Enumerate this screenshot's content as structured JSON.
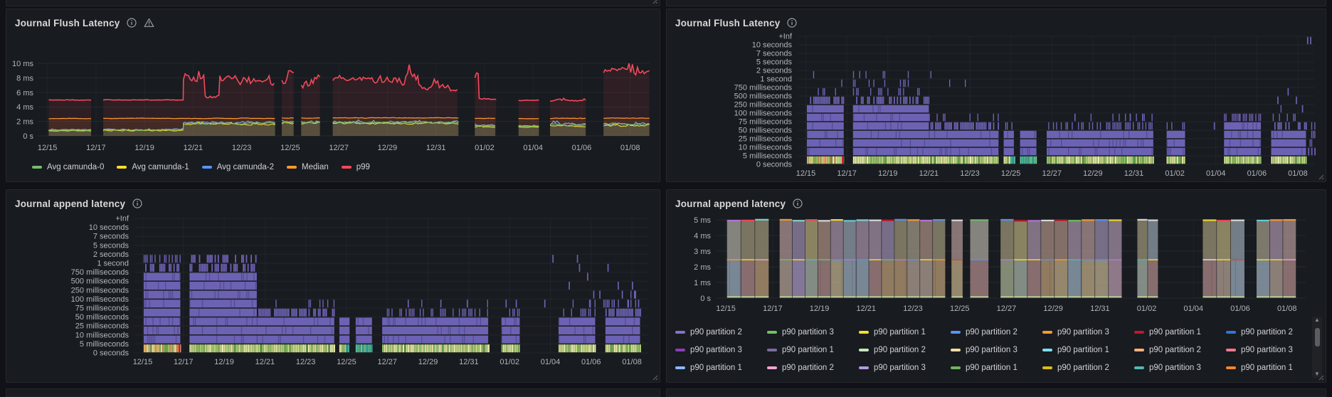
{
  "theme": {
    "page_bg": "#111217",
    "panel_bg": "#181b1f",
    "panel_border": "#25272c",
    "grid": "rgba(204,204,220,0.08)",
    "axis_text": "#b2b6bc",
    "title_text": "#d8d9da",
    "heat_cell": "#6c62b4",
    "heat_dark": "#403a72",
    "red_mark": "#d10e2c"
  },
  "dates": [
    "12/15",
    "12/17",
    "12/19",
    "12/21",
    "12/23",
    "12/25",
    "12/27",
    "12/29",
    "12/31",
    "01/02",
    "01/04",
    "01/06",
    "01/08"
  ],
  "heat_rows": [
    "+Inf",
    "10 seconds",
    "7 seconds",
    "5 seconds",
    "2 seconds",
    "1 second",
    "750 milliseconds",
    "500 milliseconds",
    "250 milliseconds",
    "100 milliseconds",
    "75 milliseconds",
    "50 milliseconds",
    "25 milliseconds",
    "10 milliseconds",
    "5 milliseconds",
    "0 seconds"
  ],
  "panels": {
    "flush_line": {
      "title": "Journal Flush Latency"
    },
    "flush_heatmap": {
      "title": "Journal Flush Latency"
    },
    "append_heatmap": {
      "title": "Journal append latency"
    },
    "append_bars": {
      "title": "Journal append latency",
      "legend_rows": [
        [
          {
            "label": "p90 partition 2",
            "color": "#8173c9"
          },
          {
            "label": "p90 partition 3",
            "color": "#73bf69"
          },
          {
            "label": "p90 partition 1",
            "color": "#fade2a"
          },
          {
            "label": "p90 partition 2",
            "color": "#5794f2"
          },
          {
            "label": "p90 partition 3",
            "color": "#ff9830"
          },
          {
            "label": "p90 partition 1",
            "color": "#c4162a"
          },
          {
            "label": "p90 partition 2",
            "color": "#3274d9"
          }
        ],
        [
          {
            "label": "p90 partition 3",
            "color": "#8f3bb8"
          },
          {
            "label": "p90 partition 1",
            "color": "#7d6b9e"
          },
          {
            "label": "p90 partition 2",
            "color": "#c8e6b8"
          },
          {
            "label": "p90 partition 3",
            "color": "#f0dea0"
          },
          {
            "label": "p90 partition 1",
            "color": "#7edcf2"
          },
          {
            "label": "p90 partition 2",
            "color": "#f7b176"
          },
          {
            "label": "p90 partition 3",
            "color": "#f2778d"
          }
        ],
        [
          {
            "label": "p90 partition 1",
            "color": "#8ab8ff"
          },
          {
            "label": "p90 partition 2",
            "color": "#f2a3d0"
          },
          {
            "label": "p90 partition 3",
            "color": "#b49be0"
          },
          {
            "label": "p90 partition 1",
            "color": "#6fb45f"
          },
          {
            "label": "p90 partition 2",
            "color": "#debb16"
          },
          {
            "label": "p90 partition 3",
            "color": "#54b8ae"
          },
          {
            "label": "p90 partition 1",
            "color": "#f2862c"
          }
        ]
      ]
    }
  },
  "legend_flush": [
    {
      "label": "Avg camunda-0",
      "color": "#73bf69"
    },
    {
      "label": "Avg camunda-1",
      "color": "#fade2a"
    },
    {
      "label": "Avg camunda-2",
      "color": "#5794f2"
    },
    {
      "label": "Median",
      "color": "#ff9830"
    },
    {
      "label": "p99",
      "color": "#f2495c"
    }
  ],
  "chart_data": [
    {
      "id": "flush_line",
      "type": "line",
      "unit": "ms",
      "ylim": [
        0,
        10.4
      ],
      "y_ticks": [
        "10 ms",
        "8 ms",
        "6 ms",
        "4 ms",
        "2 ms",
        "0 s"
      ],
      "series": [
        {
          "name": "p99",
          "color": "#f2495c",
          "fill": "rgba(242,73,92,0.10)",
          "w": 1.6,
          "segments": [
            [
              0.05,
              1.85,
              4.95,
              0.03
            ],
            [
              2.3,
              5.6,
              4.95,
              0.03
            ],
            [
              5.6,
              6.5,
              8.1,
              0.9
            ],
            [
              6.5,
              7.1,
              5.3,
              0.25
            ],
            [
              7.1,
              9.4,
              7.7,
              0.55
            ],
            [
              9.65,
              10.15,
              8.4,
              1.0
            ],
            [
              10.45,
              11.25,
              7.6,
              0.8
            ],
            [
              11.75,
              14.2,
              7.8,
              0.5
            ],
            [
              14.2,
              15.3,
              8.0,
              0.8
            ],
            [
              15.3,
              16.6,
              6.7,
              0.45
            ],
            [
              16.6,
              16.95,
              6.35,
              0.2
            ],
            [
              17.6,
              17.78,
              8.5,
              0.9
            ],
            [
              17.78,
              18.5,
              5.05,
              0.07
            ],
            [
              19.4,
              20.3,
              4.92,
              0.04
            ],
            [
              20.7,
              22.2,
              4.87,
              0.12
            ],
            [
              22.9,
              24.8,
              8.9,
              0.45
            ]
          ]
        },
        {
          "name": "Median",
          "color": "#ff9830",
          "fill": "rgba(255,152,48,0.10)",
          "w": 1.2,
          "segments": [
            [
              0.05,
              1.85,
              2.38,
              0.02
            ],
            [
              2.3,
              9.4,
              2.42,
              0.03
            ],
            [
              9.65,
              10.15,
              2.45,
              0.05
            ],
            [
              10.45,
              11.25,
              2.45,
              0.04
            ],
            [
              11.75,
              16.95,
              2.48,
              0.04
            ],
            [
              17.6,
              18.5,
              2.4,
              0.03
            ],
            [
              19.4,
              20.3,
              2.38,
              0.02
            ],
            [
              20.7,
              22.2,
              2.42,
              0.04
            ],
            [
              22.9,
              24.8,
              2.45,
              0.04
            ]
          ]
        },
        {
          "name": "Avg camunda-2",
          "color": "#8da9dc",
          "fill": "rgba(87,148,242,0.09)",
          "w": 1.1,
          "segments": [
            [
              0.05,
              1.85,
              0.85,
              0.06
            ],
            [
              2.3,
              5.6,
              0.88,
              0.08
            ],
            [
              5.6,
              9.4,
              1.85,
              0.14
            ],
            [
              9.65,
              10.15,
              2.0,
              0.2
            ],
            [
              10.45,
              11.25,
              1.95,
              0.15
            ],
            [
              11.75,
              16.95,
              1.9,
              0.14
            ],
            [
              17.6,
              18.5,
              1.45,
              0.1
            ],
            [
              19.4,
              20.3,
              1.38,
              0.06
            ],
            [
              20.7,
              22.2,
              1.6,
              0.18
            ],
            [
              22.9,
              24.8,
              1.7,
              0.15
            ]
          ]
        },
        {
          "name": "Avg camunda-1",
          "color": "#fade2a",
          "fill": "rgba(250,222,42,0.09)",
          "w": 1.1,
          "segments": [
            [
              0.05,
              1.85,
              0.7,
              0.05
            ],
            [
              2.3,
              5.6,
              0.75,
              0.06
            ],
            [
              5.6,
              9.4,
              1.62,
              0.1
            ],
            [
              9.65,
              10.15,
              1.8,
              0.15
            ],
            [
              10.45,
              11.25,
              1.75,
              0.12
            ],
            [
              11.75,
              16.95,
              1.72,
              0.1
            ],
            [
              17.6,
              18.5,
              1.28,
              0.08
            ],
            [
              19.4,
              20.3,
              1.22,
              0.05
            ],
            [
              20.7,
              22.2,
              1.4,
              0.12
            ],
            [
              22.9,
              24.8,
              1.45,
              0.15
            ]
          ]
        },
        {
          "name": "Avg camunda-0",
          "color": "#73bf69",
          "fill": "rgba(115,191,105,0.11)",
          "w": 1.1,
          "segments": [
            [
              0.05,
              1.85,
              0.78,
              0.05
            ],
            [
              2.3,
              5.6,
              0.82,
              0.07
            ],
            [
              5.6,
              9.4,
              1.72,
              0.1
            ],
            [
              9.65,
              10.15,
              1.9,
              0.15
            ],
            [
              10.45,
              11.25,
              1.85,
              0.12
            ],
            [
              11.75,
              16.95,
              1.82,
              0.1
            ],
            [
              17.6,
              18.5,
              1.38,
              0.08
            ],
            [
              19.4,
              20.3,
              1.32,
              0.05
            ],
            [
              20.7,
              22.2,
              1.55,
              0.15
            ],
            [
              22.9,
              24.8,
              1.65,
              0.12
            ]
          ]
        }
      ]
    },
    {
      "id": "flush_heatmap",
      "type": "heatmap",
      "unit": "latency buckets",
      "chunks": [
        {
          "x": [
            0.05,
            1.85
          ],
          "solid_top": 6,
          "stripes": {
            "7": 0.55,
            "8": 0.3,
            "9": 0.15,
            "10": 0.07
          },
          "strip": "warm",
          "red_end": true
        },
        {
          "x": [
            2.3,
            6.0
          ],
          "solid_top": 6,
          "stripes": {
            "7": 0.6,
            "8": 0.32,
            "9": 0.16,
            "10": 0.07
          }
        },
        {
          "x": [
            6.0,
            9.4
          ],
          "solid_top": 3,
          "stripes": {
            "4": 0.75,
            "5": 0.18,
            "9": 0.05,
            "10": 0.04
          }
        },
        {
          "x": [
            9.65,
            10.15
          ],
          "solid_top": 3,
          "stripes": {
            "4": 0.3
          },
          "teal_end": true
        },
        {
          "x": [
            10.45,
            11.25
          ],
          "solid_top": 3,
          "strip": "teal"
        },
        {
          "x": [
            11.75,
            16.95
          ],
          "solid_top": 3,
          "stripes": {
            "4": 0.5,
            "5": 0.07
          }
        },
        {
          "x": [
            17.6,
            18.5
          ],
          "solid_top": 3,
          "stripes": {
            "4": 0.18
          }
        },
        {
          "x": [
            20.4,
            22.2
          ],
          "solid_top": 4,
          "stripes": {
            "5": 0.5
          }
        },
        {
          "x": [
            22.7,
            24.4
          ],
          "solid_top": 3,
          "stripes": {
            "4": 0.55,
            "5": 0.3,
            "6": 0.1
          }
        },
        {
          "x": [
            24.5,
            24.85
          ],
          "solid_top": 0,
          "stripes": {
            "1": 0.6,
            "2": 0.5,
            "3": 0.4,
            "4": 0.25
          },
          "no_strip": true
        }
      ],
      "singles": [
        [
          13.1,
          5
        ],
        [
          15.8,
          5
        ],
        [
          16.4,
          5
        ],
        [
          19.9,
          4
        ],
        [
          21.1,
          5
        ],
        [
          23.0,
          7
        ],
        [
          23.5,
          8
        ],
        [
          23.9,
          7
        ],
        [
          24.2,
          6
        ],
        [
          24.45,
          14
        ],
        [
          24.6,
          14
        ]
      ]
    },
    {
      "id": "append_heatmap",
      "type": "heatmap",
      "unit": "latency buckets",
      "chunks": [
        {
          "x": [
            0.05,
            1.85
          ],
          "solid_top": 8,
          "stripes": {
            "9": 0.6,
            "10": 0.5
          },
          "strip": "warm",
          "red_end": true
        },
        {
          "x": [
            2.3,
            5.6
          ],
          "solid_top": 8,
          "stripes": {
            "9": 0.7,
            "10": 0.55
          }
        },
        {
          "x": [
            5.6,
            9.4
          ],
          "solid_top": 3,
          "stripes": {
            "4": 0.7,
            "5": 0.1
          }
        },
        {
          "x": [
            9.65,
            10.15
          ],
          "solid_top": 3,
          "stripes": {
            "4": 0.2
          },
          "teal_end": true
        },
        {
          "x": [
            10.45,
            11.25
          ],
          "solid_top": 3,
          "strip": "teal"
        },
        {
          "x": [
            11.75,
            16.95
          ],
          "solid_top": 3,
          "stripes": {
            "4": 0.5,
            "5": 0.05
          }
        },
        {
          "x": [
            17.6,
            18.5
          ],
          "solid_top": 3,
          "stripes": {
            "4": 0.15
          }
        },
        {
          "x": [
            20.4,
            22.2
          ],
          "solid_top": 3,
          "stripes": {
            "4": 0.45,
            "5": 0.15
          }
        },
        {
          "x": [
            22.7,
            24.4
          ],
          "solid_top": 3,
          "stripes": {
            "4": 0.6,
            "5": 0.35,
            "6": 0.12
          }
        }
      ],
      "singles": [
        [
          13.0,
          5
        ],
        [
          14.6,
          5
        ],
        [
          15.9,
          5
        ],
        [
          17.8,
          5
        ],
        [
          18.3,
          5
        ],
        [
          19.7,
          5
        ],
        [
          20.1,
          10
        ],
        [
          20.9,
          7
        ],
        [
          21.3,
          10
        ],
        [
          21.4,
          9
        ],
        [
          21.8,
          8
        ],
        [
          21.9,
          5
        ],
        [
          22.1,
          6
        ],
        [
          22.4,
          6
        ],
        [
          22.6,
          5
        ],
        [
          22.8,
          9
        ],
        [
          23.1,
          5
        ],
        [
          23.3,
          7
        ],
        [
          23.5,
          6
        ],
        [
          23.8,
          5
        ],
        [
          24.0,
          7
        ],
        [
          24.1,
          6
        ],
        [
          24.3,
          5
        ]
      ]
    },
    {
      "id": "append_bars",
      "type": "bar-stacked",
      "unit": "ms",
      "ylim": [
        0,
        5
      ],
      "y_ticks": [
        "5 ms",
        "4 ms",
        "3 ms",
        "2 ms",
        "1 ms",
        "0 s"
      ],
      "split_level": 2.45,
      "top_level": 4.95,
      "chunks": [
        [
          0.05,
          1.85
        ],
        [
          2.3,
          9.4
        ],
        [
          9.65,
          10.15
        ],
        [
          10.45,
          11.25
        ],
        [
          11.75,
          16.95
        ],
        [
          17.6,
          18.5
        ],
        [
          20.4,
          22.2
        ],
        [
          22.7,
          24.4
        ]
      ],
      "lower_palette": [
        "#9b8bb4",
        "#a3958b",
        "#9aa287",
        "#b1a07e",
        "#a98da0",
        "#ab9170",
        "#9aa59b",
        "#a08080",
        "#8f9fae",
        "#b0a487"
      ],
      "upper_palette": [
        "#9a8278",
        "#97859a",
        "#8f8a70",
        "#87949f",
        "#ad9779",
        "#9e9b92",
        "#8d809f",
        "#a39b72",
        "#a08a8a",
        "#938e7c"
      ],
      "top_accents": [
        "#fade2a",
        "#f2495c",
        "#73bf69",
        "#5794f2",
        "#ff9830",
        "#e0e0e0",
        "#b877d9",
        "#6ed0e0",
        "#c4162a",
        "#84d9d2"
      ],
      "mid_accents": [
        "#ff9830",
        "#f2a3d0",
        "#e8e8e8",
        "#5794f2",
        "#fade2a",
        "#73bf69",
        "#54b8ae",
        "#d44a3a",
        "#b877d9"
      ],
      "bottom_line": "#d9ecb2"
    }
  ]
}
